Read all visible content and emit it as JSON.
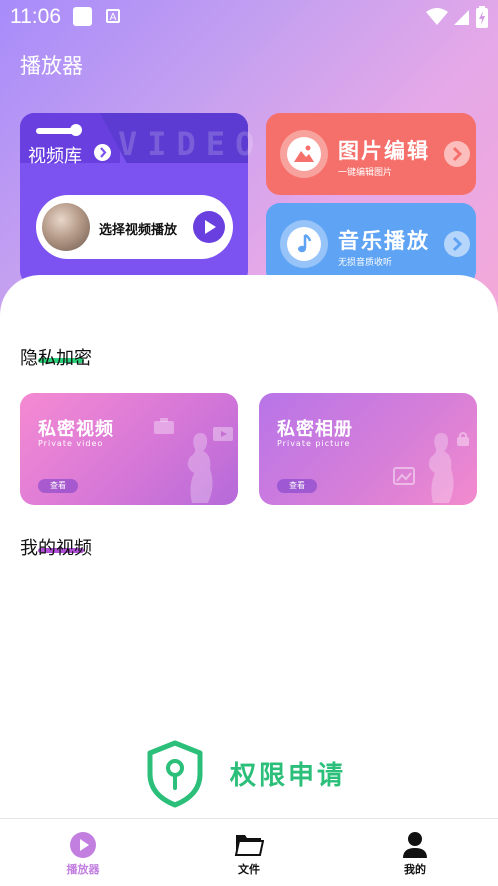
{
  "status_bar": {
    "time": "11:06"
  },
  "app": {
    "title": "播放器"
  },
  "video_card": {
    "label": "视频库",
    "watermark": "VIDEO",
    "pick_text": "选择视频播放"
  },
  "features": [
    {
      "title": "图片编辑",
      "subtitle": "一键编辑图片",
      "color": "#f5706a",
      "icon": "image-icon"
    },
    {
      "title": "音乐播放",
      "subtitle": "无损音质收听",
      "color": "#5ea3f4",
      "icon": "music-note-icon"
    }
  ],
  "sections": {
    "privacy": {
      "title": "隐私加密",
      "accent": "#2bd07a"
    },
    "my_videos": {
      "title": "我的视频",
      "accent": "#b14fd8"
    }
  },
  "privacy_cards": [
    {
      "title": "私密视频",
      "subtitle": "Private video",
      "button": "查看"
    },
    {
      "title": "私密相册",
      "subtitle": "Private picture",
      "button": "查看"
    }
  ],
  "permission": {
    "text": "权限申请",
    "color": "#2bbf7a"
  },
  "tabs": [
    {
      "label": "播放器",
      "active": true,
      "color": "#c27fe0",
      "icon": "play-circle-icon"
    },
    {
      "label": "文件",
      "active": false,
      "color": "#111111",
      "icon": "folder-icon"
    },
    {
      "label": "我的",
      "active": false,
      "color": "#111111",
      "icon": "person-icon"
    }
  ]
}
